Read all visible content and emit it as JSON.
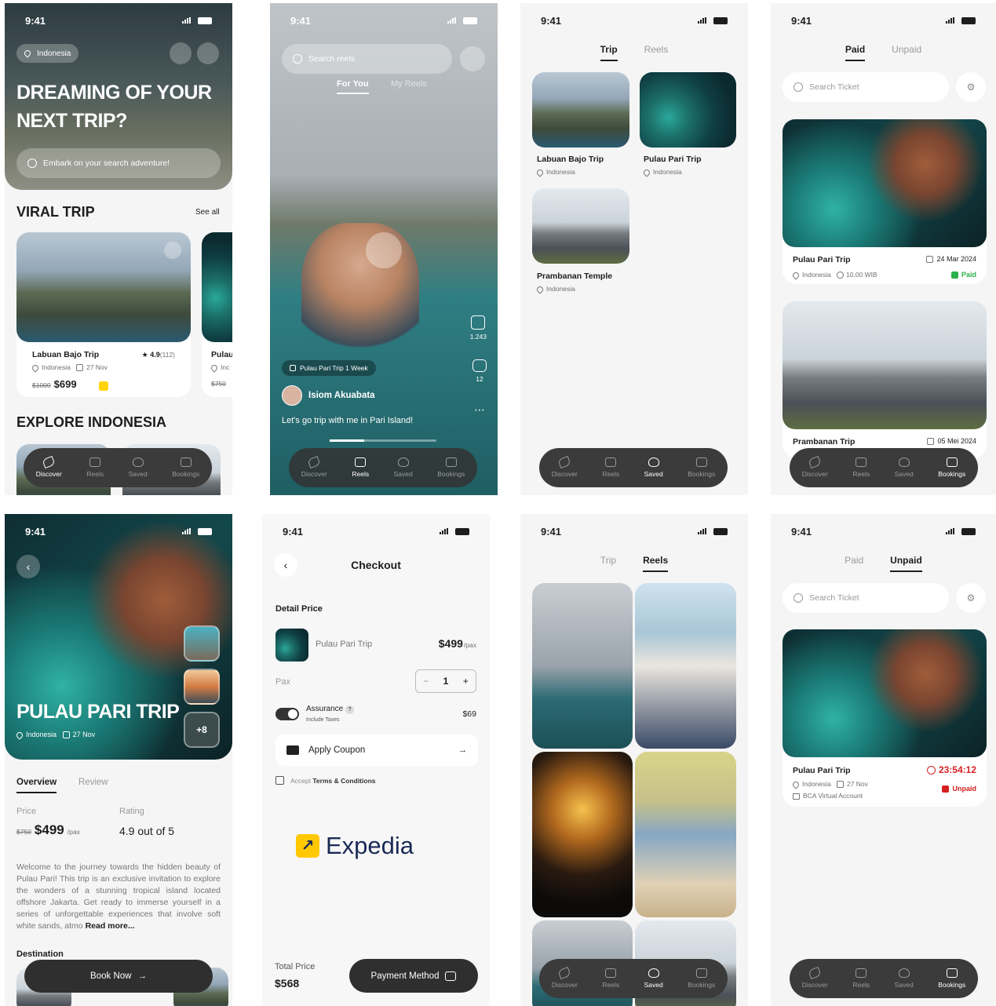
{
  "status_time": "9:41",
  "nav": {
    "discover": "Discover",
    "reels": "Reels",
    "saved": "Saved",
    "bookings": "Bookings"
  },
  "s1": {
    "location": "Indonesia",
    "headline1": "DREAMING OF YOUR",
    "headline2": "NEXT TRIP?",
    "search_placeholder": "Embark on your search adventure!",
    "viral": "VIRAL TRIP",
    "see_all": "See all",
    "card": {
      "name": "Labuan Bajo Trip",
      "rating": "4.9",
      "count": "(112)",
      "loc": "Indonesia",
      "date": "27 Nov",
      "old": "$1000",
      "price": "$699"
    },
    "card2": {
      "name": "Pulau",
      "loc": "Inc",
      "old": "$750"
    },
    "explore": "EXPLORE INDONESIA"
  },
  "s2": {
    "search": "Search reels",
    "tab1": "For You",
    "tab2": "My Reels",
    "likes": "1.243",
    "comments": "12",
    "tag": "Pulau Pari Trip 1 Week",
    "user": "Isiom Akuabata",
    "caption": "Let's go trip with me in Pari Island!"
  },
  "s3": {
    "tab1": "Trip",
    "tab2": "Reels",
    "items": [
      {
        "name": "Labuan Bajo Trip",
        "loc": "Indonesia"
      },
      {
        "name": "Pulau Pari Trip",
        "loc": "Indonesia"
      },
      {
        "name": "Prambanan Temple",
        "loc": "Indonesia"
      }
    ]
  },
  "s4": {
    "tab1": "Paid",
    "tab2": "Unpaid",
    "search": "Search Ticket",
    "t1": {
      "name": "Pulau Pari Trip",
      "date": "24 Mar 2024",
      "loc": "Indonesia",
      "time": "10.00 WIB",
      "status": "Paid"
    },
    "t2": {
      "name": "Prambanan Trip",
      "date": "05 Mei 2024"
    }
  },
  "s5": {
    "title": "PULAU PARI TRIP",
    "loc": "Indonesia",
    "date": "27 Nov",
    "more": "+8",
    "tab1": "Overview",
    "tab2": "Review",
    "price_label": "Price",
    "rating_label": "Rating",
    "old": "$750",
    "price": "$499",
    "pax": "/pax",
    "rating": "4.9 out of 5",
    "desc": "Welcome to the journey towards the hidden beauty of Pulau Pari! This trip is an exclusive invitation to explore the wonders of a stunning tropical island located offshore Jakarta. Get ready to immerse yourself in a series of unforgettable experiences that involve soft white sands, atmo",
    "read_more": "Read more...",
    "destination": "Destination",
    "book": "Book Now"
  },
  "s6": {
    "title": "Checkout",
    "detail": "Detail Price",
    "trip": "Pulau Pari Trip",
    "price": "$499",
    "pax_unit": "/pax",
    "pax": "Pax",
    "qty": "1",
    "minus": "−",
    "plus": "+",
    "assurance": "Assurance",
    "include": "Include Taxes",
    "assurance_price": "$69",
    "coupon": "Apply Coupon",
    "accept": "Accept ",
    "terms": "Terms & Conditions",
    "brand": "Expedia",
    "total_label": "Total Price",
    "total": "$568",
    "pay": "Payment Method"
  },
  "s7": {
    "tab1": "Trip",
    "tab2": "Reels"
  },
  "s8": {
    "tab1": "Paid",
    "tab2": "Unpaid",
    "search": "Search Ticket",
    "name": "Pulau Pari Trip",
    "countdown": "23:54:12",
    "loc": "Indonesia",
    "date": "27 Nov",
    "method": "BCA Virtual Account",
    "status": "Unpaid"
  }
}
